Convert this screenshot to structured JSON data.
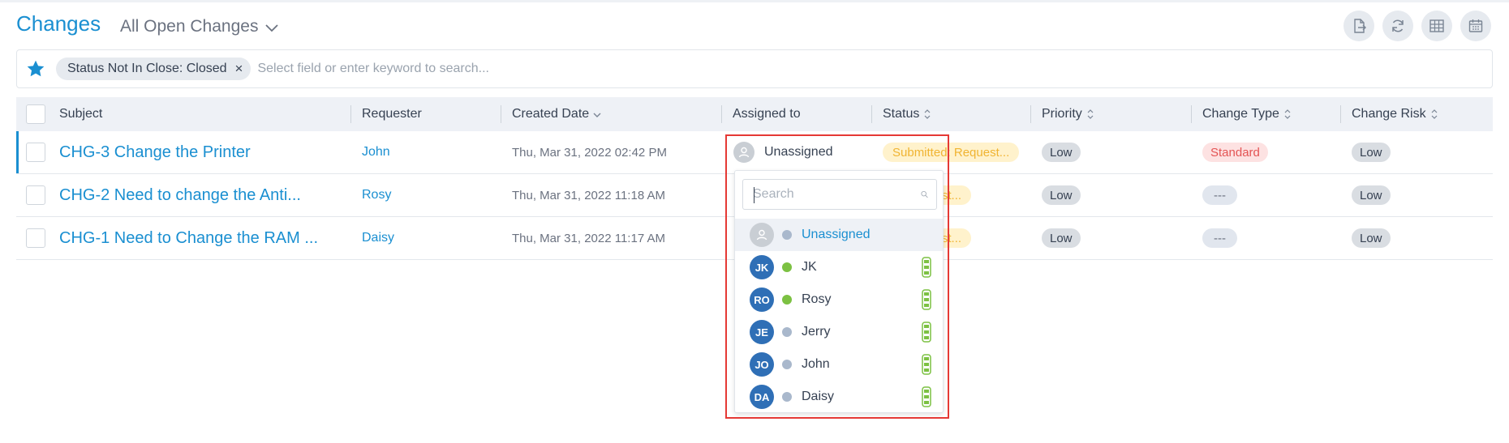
{
  "header": {
    "title": "Changes",
    "view_label": "All Open Changes",
    "actions": [
      {
        "name": "export-icon"
      },
      {
        "name": "refresh-icon"
      },
      {
        "name": "table-view-icon"
      },
      {
        "name": "calendar-view-icon"
      }
    ]
  },
  "search": {
    "filter_chip": "Status Not In Close: Closed",
    "chip_close": "×",
    "placeholder": "Select field or enter keyword to search..."
  },
  "table": {
    "columns": {
      "subject": "Subject",
      "requester": "Requester",
      "created_date": "Created Date",
      "assigned_to": "Assigned to",
      "status": "Status",
      "priority": "Priority",
      "change_type": "Change Type",
      "change_risk": "Change Risk"
    },
    "rows": [
      {
        "subject": "CHG-3 Change the Printer",
        "requester": "John",
        "created": "Thu, Mar 31, 2022 02:42 PM",
        "assigned": "Unassigned",
        "status": "Submitted: Request...",
        "priority": "Low",
        "change_type": "Standard",
        "change_risk": "Low"
      },
      {
        "subject": "CHG-2 Need to change the Anti...",
        "requester": "Rosy",
        "created": "Thu, Mar 31, 2022 11:18 AM",
        "assigned": "",
        "status": "d: Request...",
        "priority": "Low",
        "change_type": "---",
        "change_risk": "Low"
      },
      {
        "subject": "CHG-1 Need to Change the RAM ...",
        "requester": "Daisy",
        "created": "Thu, Mar 31, 2022 11:17 AM",
        "assigned": "",
        "status": "d: Request...",
        "priority": "Low",
        "change_type": "---",
        "change_risk": "Low"
      }
    ]
  },
  "assign_dropdown": {
    "search_placeholder": "Search",
    "items": [
      {
        "initials": "",
        "name": "Unassigned",
        "presence": "#a9b8cc"
      },
      {
        "initials": "JK",
        "name": "JK",
        "presence": "#7cc142"
      },
      {
        "initials": "RO",
        "name": "Rosy",
        "presence": "#7cc142"
      },
      {
        "initials": "JE",
        "name": "Jerry",
        "presence": "#a9b8cc"
      },
      {
        "initials": "JO",
        "name": "John",
        "presence": "#a9b8cc"
      },
      {
        "initials": "DA",
        "name": "Daisy",
        "presence": "#a9b8cc"
      }
    ]
  },
  "colors": {
    "accent": "#1a8fd1",
    "highlight_border": "#e53935",
    "status_bg": "#fff2cc",
    "status_text": "#f0b432",
    "standard_bg": "#fde2e2",
    "standard_text": "#e45454",
    "avatar_bg": "#2f6fb6",
    "online": "#7cc142",
    "offline": "#a9b8cc"
  }
}
